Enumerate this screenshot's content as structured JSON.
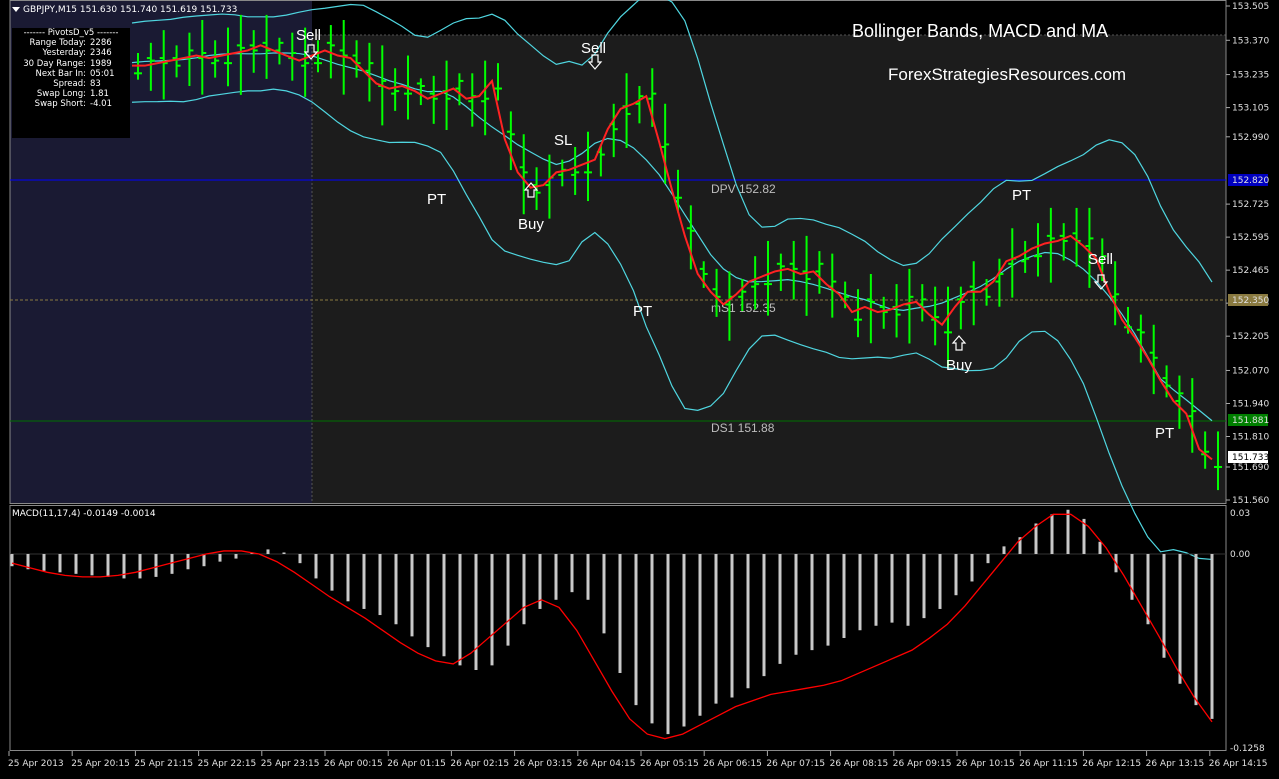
{
  "window": {
    "symbol_header": "GBPJPY,M15  151.630 151.740 151.619 151.733",
    "macd_header": "MACD(11,17,4) -0.0149 -0.0014",
    "title": "Bollinger Bands, MACD and  MA",
    "subtitle": "ForexStrategiesResources.com"
  },
  "info_panel": {
    "heading": "-------  PivotsD_v5  -------",
    "rows": [
      {
        "label": "Range Today:",
        "value": "2286"
      },
      {
        "label": "Yesterday:",
        "value": "2346"
      },
      {
        "label": "30 Day Range:",
        "value": "1989"
      },
      {
        "label": "Next Bar In:",
        "value": "05:01"
      },
      {
        "label": "Spread:",
        "value": "83"
      },
      {
        "label": "Swap Long:",
        "value": "1.81"
      },
      {
        "label": "Swap Short:",
        "value": "-4.01"
      }
    ]
  },
  "pivot_lines": {
    "dpv": "DPV  152.82",
    "ms1": "mS1  152.35",
    "ds1": "DS1  151.88"
  },
  "price_axis": [
    "153.505",
    "153.370",
    "153.235",
    "153.105",
    "152.990",
    "152.725",
    "152.595",
    "152.465",
    "152.335",
    "152.205",
    "152.070",
    "151.940",
    "151.810",
    "151.690",
    "151.560"
  ],
  "price_axis_labels_special": {
    "dpv_tag": "152.820",
    "ms1_tag": "152.350",
    "ds1_tag": "151.881",
    "last_price_tag": "151.733"
  },
  "macd_axis": [
    "0.03",
    "0.00",
    "-0.1258"
  ],
  "time_axis": [
    "25 Apr 2013",
    "25 Apr 20:15",
    "25 Apr 21:15",
    "25 Apr 22:15",
    "25 Apr 23:15",
    "26 Apr 00:15",
    "26 Apr 01:15",
    "26 Apr 02:15",
    "26 Apr 03:15",
    "26 Apr 04:15",
    "26 Apr 05:15",
    "26 Apr 06:15",
    "26 Apr 07:15",
    "26 Apr 08:15",
    "26 Apr 09:15",
    "26 Apr 10:15",
    "26 Apr 11:15",
    "26 Apr 12:15",
    "26 Apr 13:15",
    "26 Apr 14:15"
  ],
  "annotations": {
    "sell_1": "Sell",
    "sell_2": "Sell",
    "sell_3": "Sell",
    "buy_1": "Buy",
    "buy_2": "Buy",
    "pt_1": "PT",
    "pt_2": "PT",
    "pt_3": "PT",
    "pt_4": "PT",
    "sl_1": "SL"
  },
  "colors": {
    "background": "#000000",
    "chart_panel": "#1c1c1c",
    "session_shade": "#1a1a33",
    "bars": "#00ff00",
    "ma": "#ff2222",
    "bands": "#4fd6e0",
    "dpv_line": "#0000ff",
    "ms1_line": "#8a7a40",
    "ds1_line": "#006400",
    "macd_hist": "#c8c8c8",
    "macd_signal": "#ff0000"
  },
  "chart_data": {
    "type": "line",
    "symbol": "GBPJPY",
    "timeframe": "M15",
    "ylim": [
      151.56,
      153.505
    ],
    "ma_close": [
      153.27,
      153.27,
      153.28,
      153.29,
      153.3,
      153.31,
      153.3,
      153.31,
      153.32,
      153.33,
      153.35,
      153.33,
      153.31,
      153.29,
      153.31,
      153.33,
      153.31,
      153.3,
      153.25,
      153.2,
      153.18,
      153.19,
      153.17,
      153.14,
      153.16,
      153.18,
      153.14,
      153.15,
      153.21,
      152.98,
      152.85,
      152.79,
      152.8,
      152.85,
      152.86,
      152.88,
      152.9,
      153.02,
      153.1,
      153.12,
      153.15,
      152.97,
      152.78,
      152.6,
      152.45,
      152.38,
      152.33,
      152.37,
      152.42,
      152.44,
      152.46,
      152.47,
      152.45,
      152.46,
      152.41,
      152.37,
      152.3,
      152.32,
      152.3,
      152.31,
      152.33,
      152.34,
      152.29,
      152.25,
      152.32,
      152.38,
      152.38,
      152.42,
      152.5,
      152.52,
      152.55,
      152.57,
      152.58,
      152.6,
      152.56,
      152.51,
      152.38,
      152.27,
      152.2,
      152.12,
      152.03,
      151.95,
      151.9,
      151.76,
      151.72
    ],
    "macd_hist": [
      -0.008,
      -0.01,
      -0.011,
      -0.012,
      -0.013,
      -0.014,
      -0.015,
      -0.016,
      -0.016,
      -0.015,
      -0.013,
      -0.01,
      -0.008,
      -0.005,
      -0.003,
      0.001,
      0.003,
      0.001,
      -0.006,
      -0.016,
      -0.024,
      -0.031,
      -0.036,
      -0.04,
      -0.046,
      -0.054,
      -0.061,
      -0.067,
      -0.073,
      -0.076,
      -0.073,
      -0.06,
      -0.046,
      -0.036,
      -0.03,
      -0.025,
      -0.03,
      -0.052,
      -0.078,
      -0.099,
      -0.111,
      -0.118,
      -0.113,
      -0.106,
      -0.098,
      -0.094,
      -0.088,
      -0.08,
      -0.072,
      -0.066,
      -0.063,
      -0.06,
      -0.055,
      -0.05,
      -0.047,
      -0.045,
      -0.047,
      -0.042,
      -0.036,
      -0.027,
      -0.018,
      -0.006,
      0.005,
      0.011,
      0.02,
      0.026,
      0.029,
      0.023,
      0.008,
      -0.012,
      -0.03,
      -0.046,
      -0.068,
      -0.085,
      -0.099,
      -0.108
    ],
    "macd_signal": [
      -0.006,
      -0.009,
      -0.012,
      -0.014,
      -0.015,
      -0.015,
      -0.014,
      -0.012,
      -0.009,
      -0.006,
      -0.003,
      0.0,
      0.002,
      0.002,
      0.0,
      -0.005,
      -0.012,
      -0.02,
      -0.028,
      -0.035,
      -0.042,
      -0.05,
      -0.058,
      -0.065,
      -0.07,
      -0.072,
      -0.065,
      -0.055,
      -0.045,
      -0.035,
      -0.03,
      -0.035,
      -0.05,
      -0.07,
      -0.09,
      -0.108,
      -0.118,
      -0.121,
      -0.118,
      -0.112,
      -0.106,
      -0.1,
      -0.096,
      -0.092,
      -0.09,
      -0.088,
      -0.086,
      -0.083,
      -0.078,
      -0.073,
      -0.068,
      -0.063,
      -0.055,
      -0.046,
      -0.034,
      -0.02,
      -0.006,
      0.008,
      0.018,
      0.026,
      0.026,
      0.018,
      0.004,
      -0.014,
      -0.034,
      -0.054,
      -0.075,
      -0.094,
      -0.11
    ],
    "legend": "MACD(11,17,4)"
  }
}
